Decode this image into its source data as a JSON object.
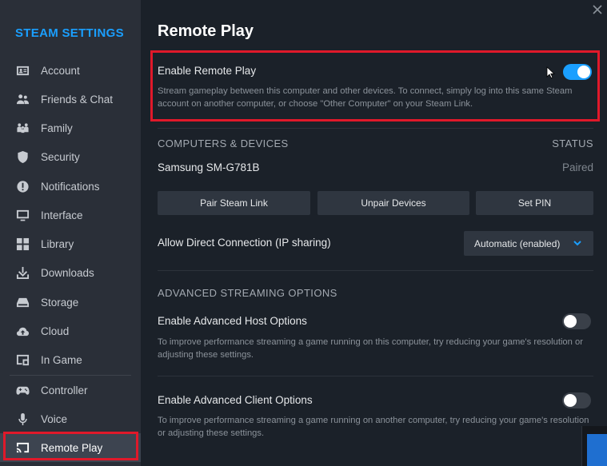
{
  "sidebar": {
    "title": "STEAM SETTINGS",
    "items": [
      {
        "label": "Account",
        "icon": "account-card-icon"
      },
      {
        "label": "Friends & Chat",
        "icon": "friends-icon"
      },
      {
        "label": "Family",
        "icon": "family-icon"
      },
      {
        "label": "Security",
        "icon": "shield-icon"
      },
      {
        "label": "Notifications",
        "icon": "notification-icon"
      },
      {
        "label": "Interface",
        "icon": "monitor-icon"
      },
      {
        "label": "Library",
        "icon": "grid-icon"
      },
      {
        "label": "Downloads",
        "icon": "download-icon"
      },
      {
        "label": "Storage",
        "icon": "storage-icon"
      },
      {
        "label": "Cloud",
        "icon": "cloud-icon"
      },
      {
        "label": "In Game",
        "icon": "in-game-icon"
      },
      {
        "label": "Controller",
        "icon": "gamepad-icon"
      },
      {
        "label": "Voice",
        "icon": "microphone-icon"
      },
      {
        "label": "Remote Play",
        "icon": "cast-icon",
        "active": true
      }
    ]
  },
  "main": {
    "title": "Remote Play",
    "enable_remote_play": {
      "label": "Enable Remote Play",
      "enabled": true,
      "description": "Stream gameplay between this computer and other devices. To connect, simply log into this same Steam account on another computer, or choose \"Other Computer\" on your Steam Link."
    },
    "devices_section": {
      "header": "COMPUTERS & DEVICES",
      "status_header": "STATUS",
      "devices": [
        {
          "name": "Samsung SM-G781B",
          "status": "Paired"
        }
      ],
      "buttons": [
        "Pair Steam Link",
        "Unpair Devices",
        "Set PIN"
      ]
    },
    "direct_connection": {
      "label": "Allow Direct Connection (IP sharing)",
      "selected": "Automatic (enabled)"
    },
    "advanced_section": {
      "header": "ADVANCED STREAMING OPTIONS",
      "host": {
        "label": "Enable Advanced Host Options",
        "enabled": false,
        "description": "To improve performance streaming a game running on this computer, try reducing your game's resolution or adjusting these settings."
      },
      "client": {
        "label": "Enable Advanced Client Options",
        "enabled": false,
        "description": "To improve performance streaming a game running on another computer, try reducing your game's resolution or adjusting these settings."
      }
    }
  },
  "colors": {
    "accent": "#1a9fff",
    "highlight": "#e0192a",
    "sidebar_bg": "#2a2f38",
    "main_bg": "#1b2129"
  }
}
